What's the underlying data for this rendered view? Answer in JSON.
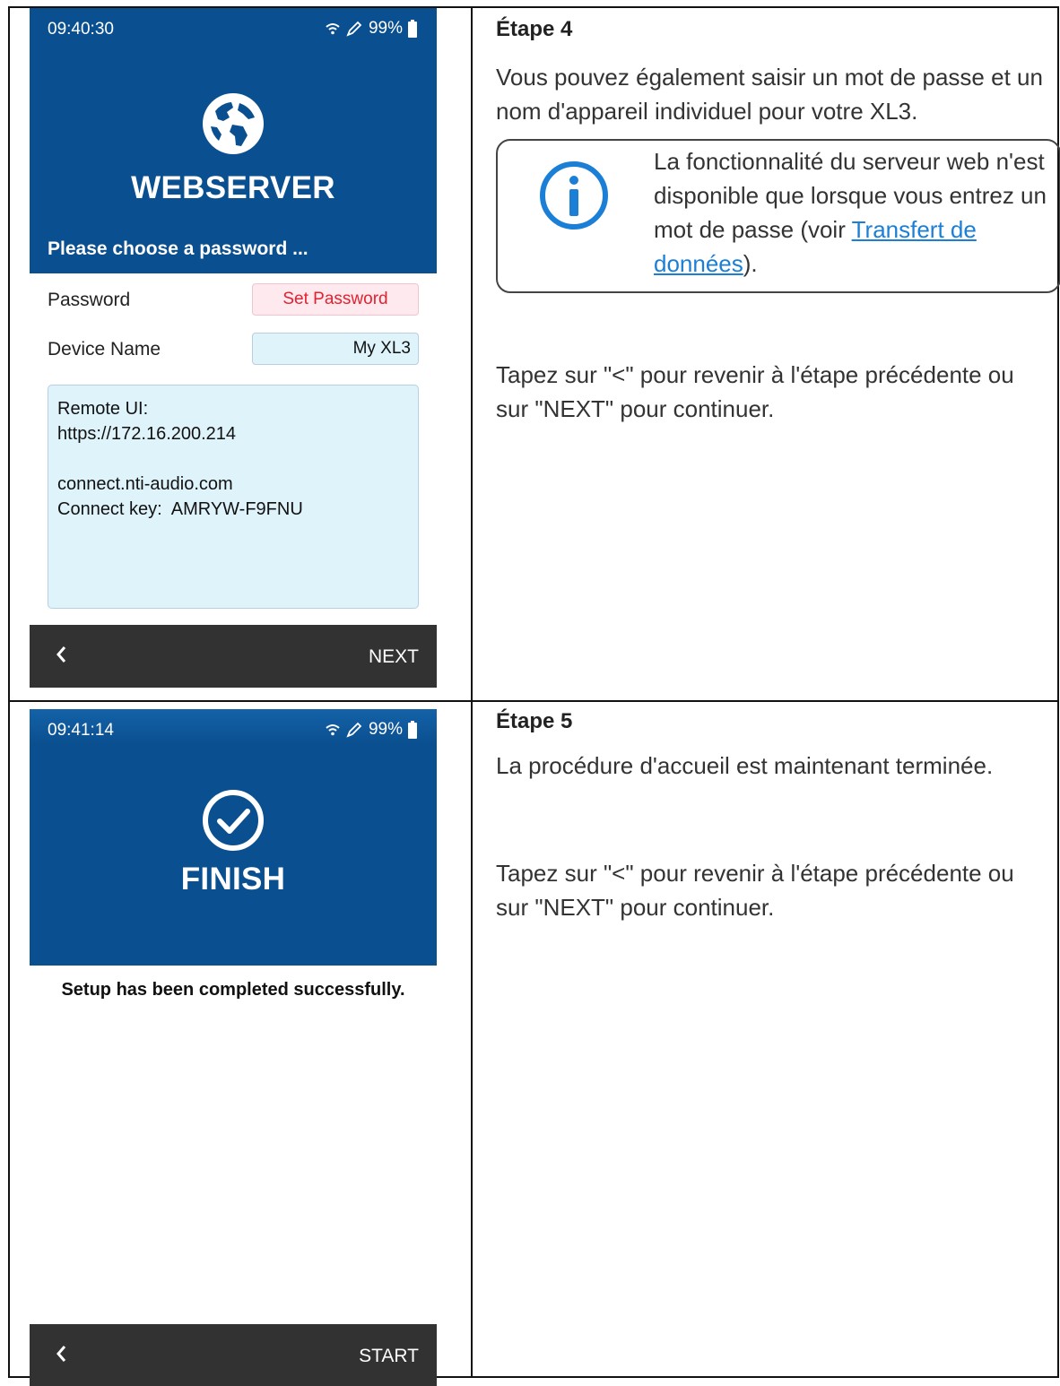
{
  "step4": {
    "device": {
      "status": {
        "time": "09:40:30",
        "battery": "99%"
      },
      "title": "WEBSERVER",
      "subtitle": "Please choose a password ...",
      "password_label": "Password",
      "password_button": "Set Password",
      "device_name_label": "Device Name",
      "device_name_value": "My XL3",
      "info_lines": [
        "Remote UI:",
        "https://172.16.200.214",
        "",
        "connect.nti-audio.com",
        "Connect key:  AMRYW-F9FNU"
      ],
      "back_label": "<",
      "next_label": "NEXT"
    },
    "heading": "Étape 4",
    "paragraph1": "Vous pouvez également saisir un mot de passe et un nom d'appareil individuel pour votre XL3.",
    "note_text_before": "La fonctionnalité du serveur web n'est disponible que lorsque vous entrez un mot de passe (voir ",
    "note_link": "Trans­fert de données",
    "note_text_after": ").",
    "paragraph2": "Tapez sur \"<\" pour revenir à l'étape précédente ou sur \"NEXT\" pour continuer."
  },
  "step5": {
    "device": {
      "status": {
        "time": "09:41:14",
        "battery": "99%"
      },
      "title": "FINISH",
      "message": "Setup has been completed successfully.",
      "back_label": "<",
      "start_label": "START"
    },
    "heading": "Étape 5",
    "paragraph1": "La procédure d'accueil est maintenant terminée.",
    "paragraph2": "Tapez sur \"<\" pour revenir à l'étape précédente ou sur \"NEXT\" pour continuer."
  },
  "colors": {
    "hero_blue": "#0a4f8f",
    "link_blue": "#1b7fd6",
    "error_red": "#e4212f",
    "bar_dark": "#323232",
    "field_bg": "#dff3fb"
  },
  "icons": {
    "globe": "globe-icon",
    "check": "check-circle-icon",
    "info": "info-icon",
    "wifi": "wifi-icon",
    "pen": "pen-icon",
    "battery": "battery-icon",
    "back": "chevron-left-icon"
  }
}
